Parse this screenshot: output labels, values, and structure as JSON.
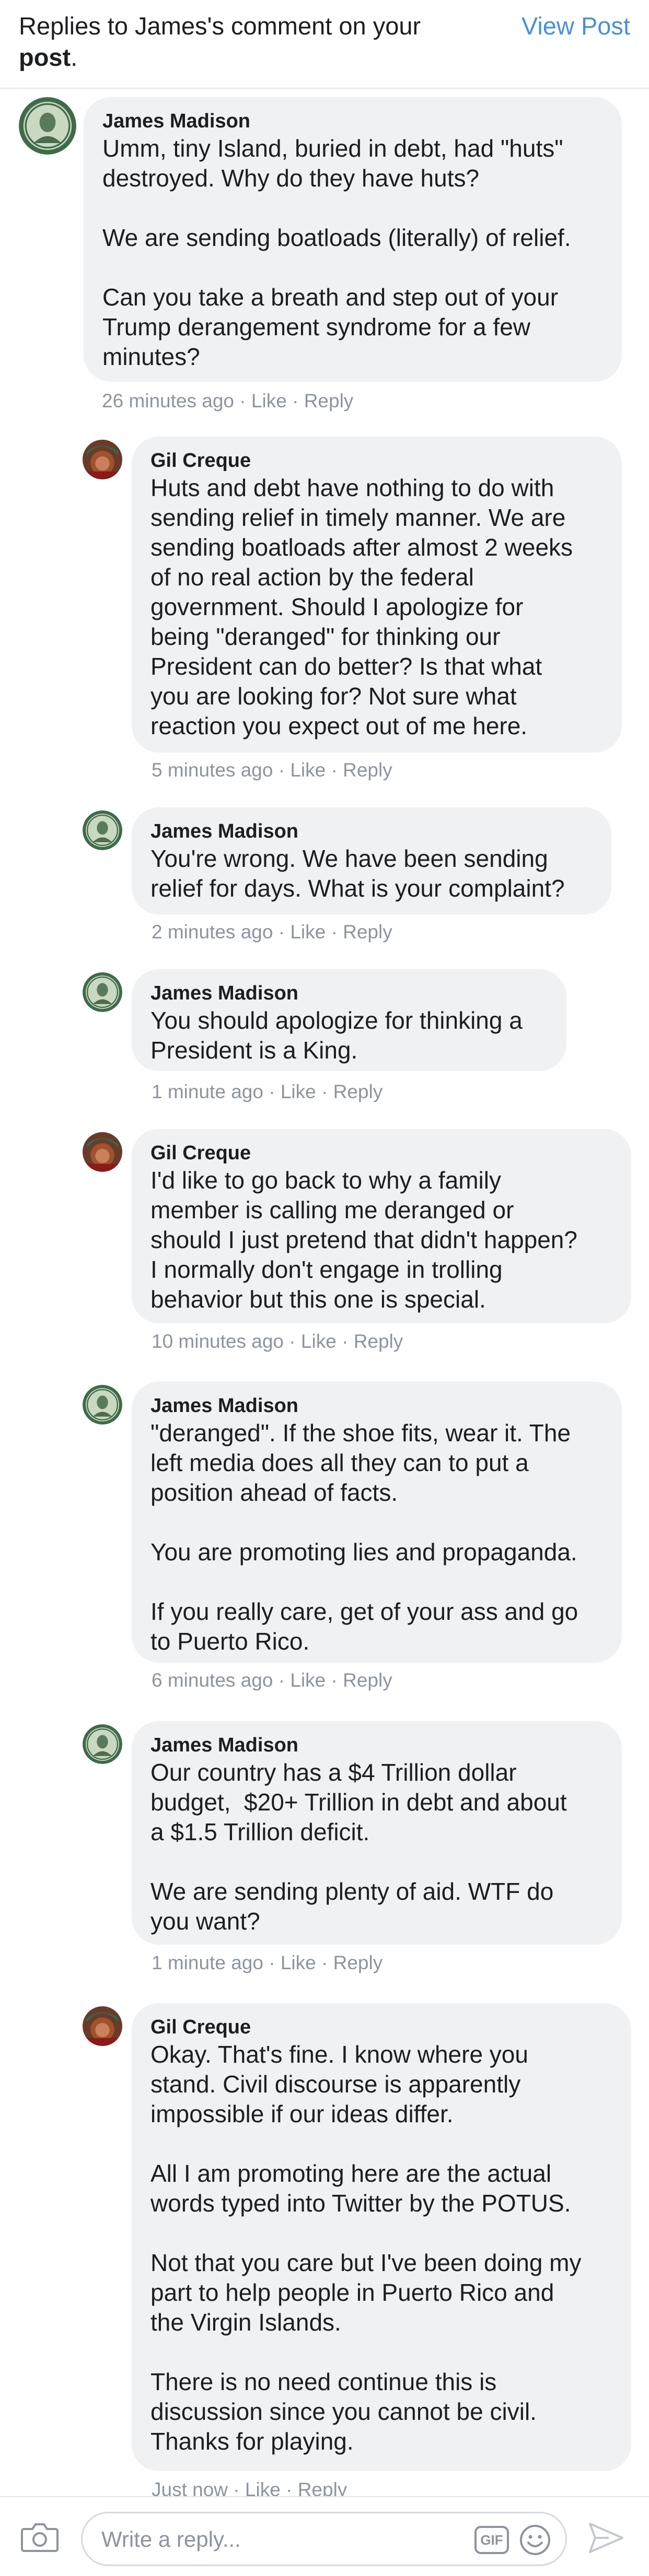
{
  "header": {
    "title_prefix": "Replies to James's comment on your",
    "title_bold": "post",
    "title_suffix": ".",
    "view_post_label": "View Post"
  },
  "comments": [
    {
      "author": "James Madison",
      "avatar": "james-madison-avatar-icon",
      "text": "Umm, tiny Island, buried in debt, had \"huts\"\ndestroyed. Why do they have huts?\n\nWe are sending boatloads (literally) of relief.\n\nCan you take a breath and step out of your\nTrump derangement syndrome for a few\nminutes?",
      "time": "26 minutes ago",
      "like": "Like",
      "reply": "Reply"
    },
    {
      "author": "Gil Creque",
      "avatar": "gil-creque-avatar-icon",
      "text": "Huts and debt have nothing to do with\nsending relief in timely manner. We are\nsending boatloads after almost 2 weeks\nof no real action by the federal\ngovernment. Should I apologize for\nbeing \"deranged\" for thinking our\nPresident can do better? Is that what\nyou are looking for? Not sure what\nreaction you expect out of me here.",
      "time": "5 minutes ago",
      "like": "Like",
      "reply": "Reply"
    },
    {
      "author": "James Madison",
      "avatar": "james-madison-avatar-icon",
      "text": "You're wrong. We have been sending\nrelief for days. What is your complaint?",
      "time": "2 minutes ago",
      "like": "Like",
      "reply": "Reply"
    },
    {
      "author": "James Madison",
      "avatar": "james-madison-avatar-icon",
      "text": "You should apologize for thinking a\nPresident is a King.",
      "time": "1 minute ago",
      "like": "Like",
      "reply": "Reply"
    },
    {
      "author": "Gil Creque",
      "avatar": "gil-creque-avatar-icon",
      "text": "I'd like to go back to why a family\nmember is calling me deranged or\nshould I just pretend that didn't happen?\nI normally don't engage in trolling\nbehavior but this one is special.",
      "time": "10 minutes ago",
      "like": "Like",
      "reply": "Reply"
    },
    {
      "author": "James Madison",
      "avatar": "james-madison-avatar-icon",
      "text": "\"deranged\". If the shoe fits, wear it. The\nleft media does all they can to put a\nposition ahead of facts.\n\nYou are promoting lies and propaganda.\n\nIf you really care, get of your ass and go\nto Puerto Rico.",
      "time": "6 minutes ago",
      "like": "Like",
      "reply": "Reply"
    },
    {
      "author": "James Madison",
      "avatar": "james-madison-avatar-icon",
      "text": "Our country has a $4 Trillion dollar\nbudget,  $20+ Trillion in debt and about\na $1.5 Trillion deficit.\n\nWe are sending plenty of aid. WTF do\nyou want?",
      "time": "1 minute ago",
      "like": "Like",
      "reply": "Reply"
    },
    {
      "author": "Gil Creque",
      "avatar": "gil-creque-avatar-icon",
      "text": "Okay. That's fine. I know where you\nstand. Civil discourse is apparently\nimpossible if our ideas differ.\n\nAll I am promoting here are the actual\nwords typed into Twitter by the POTUS.\n\nNot that you care but I've been doing my\npart to help people in Puerto Rico and\nthe Virgin Islands.\n\nThere is no need continue this is\ndiscussion since you cannot be civil.\nThanks for playing.",
      "time": "Just now",
      "like": "Like",
      "reply": "Reply"
    }
  ],
  "composer": {
    "placeholder": "Write a reply...",
    "camera_icon": "camera-icon",
    "gif_label": "GIF",
    "emoji_icon": "emoji-icon",
    "send_icon": "send-icon"
  },
  "colors": {
    "link": "#4a90d9",
    "bubble": "#f0f1f3",
    "meta": "#8d949e",
    "text": "#1c1e21"
  }
}
